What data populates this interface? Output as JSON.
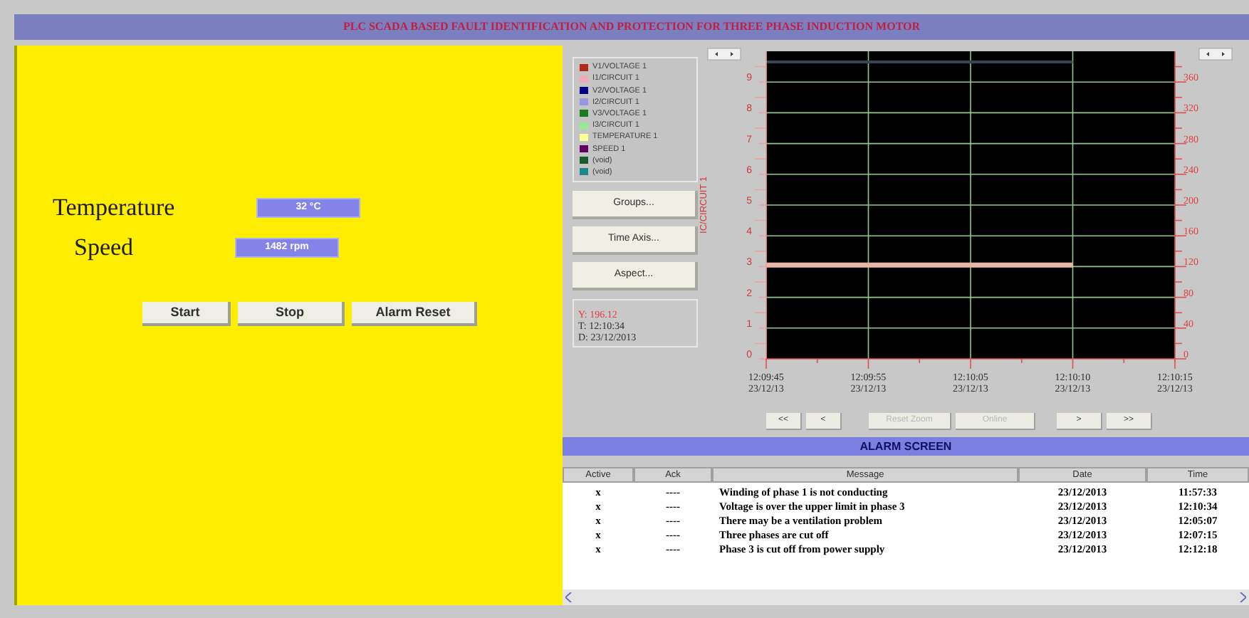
{
  "window": {
    "title": "PLC SCADA BASED FAULT IDENTIFICATION AND PROTECTION FOR THREE PHASE INDUCTION MOTOR"
  },
  "control_panel": {
    "readings": [
      {
        "label": "Temperature",
        "value": "32 °C"
      },
      {
        "label": "Speed",
        "value": "1482 rpm"
      }
    ],
    "buttons": [
      "Start",
      "Stop",
      "Alarm Reset"
    ]
  },
  "trend": {
    "legend": [
      {
        "label": "V1/VOLTAGE 1",
        "color": "#b02818"
      },
      {
        "label": "I1/CIRCUIT 1",
        "color": "#f0a8b8"
      },
      {
        "label": "V2/VOLTAGE 1",
        "color": "#000080"
      },
      {
        "label": "I2/CIRCUIT 1",
        "color": "#9898e0"
      },
      {
        "label": "V3/VOLTAGE 1",
        "color": "#1c7a1c"
      },
      {
        "label": "I3/CIRCUIT 1",
        "color": "#98e898"
      },
      {
        "label": "TEMPERATURE 1",
        "color": "#ffff98"
      },
      {
        "label": "SPEED 1",
        "color": "#600060"
      },
      {
        "label": "(void)",
        "color": "#1c5c2c"
      },
      {
        "label": "(void)",
        "color": "#208888"
      }
    ],
    "buttons": [
      "Groups...",
      "Time Axis...",
      "Aspect..."
    ],
    "cursor": [
      "Y: 196.12",
      "T: 12:10:34",
      "D: 23/12/2013"
    ],
    "left_axis_title": "IC/CIRCUIT 1",
    "left_axis_ticks": [
      "9",
      "8",
      "7",
      "6",
      "5",
      "4",
      "3",
      "2",
      "1",
      "0"
    ],
    "chart_data": {
      "type": "line",
      "grid": true,
      "ylim": [
        0,
        400
      ],
      "yticks": [
        0,
        40,
        80,
        120,
        160,
        200,
        240,
        280,
        320,
        360
      ],
      "categories": [
        "12:09:45 23/12/13",
        "12:09:55 23/12/13",
        "12:10:05 23/12/13",
        "12:10:10 23/12/13",
        "12:10:15 23/12/13"
      ],
      "series": [
        {
          "color": "#e8b4a8",
          "values": [
            122,
            122,
            122,
            122,
            null
          ]
        },
        {
          "color": "#3a4656",
          "values": [
            386,
            386,
            386,
            386,
            null
          ]
        }
      ]
    },
    "navigation": [
      {
        "label": "<<",
        "disabled": false
      },
      {
        "label": "<",
        "disabled": false
      },
      {
        "label": "Reset Zoom",
        "disabled": true
      },
      {
        "label": "Online",
        "disabled": true
      },
      {
        "label": ">",
        "disabled": false
      },
      {
        "label": ">>",
        "disabled": false
      }
    ]
  },
  "alarms": {
    "title": "ALARM SCREEN",
    "columns": [
      "Active",
      "Ack",
      "Message",
      "Date",
      "Time"
    ],
    "rows": [
      [
        "x",
        "----",
        "Winding of phase 1 is not conducting",
        "23/12/2013",
        "11:57:33"
      ],
      [
        "x",
        "----",
        "Voltage is over the upper limit in phase 3",
        "23/12/2013",
        "12:10:34"
      ],
      [
        "x",
        "----",
        "There may be a ventilation problem",
        "23/12/2013",
        "12:05:07"
      ],
      [
        "x",
        "----",
        "Three phases are cut off",
        "23/12/2013",
        "12:07:15"
      ],
      [
        "x",
        "----",
        "Phase 3 is cut off from power supply",
        "23/12/2013",
        "12:12:18"
      ]
    ]
  }
}
